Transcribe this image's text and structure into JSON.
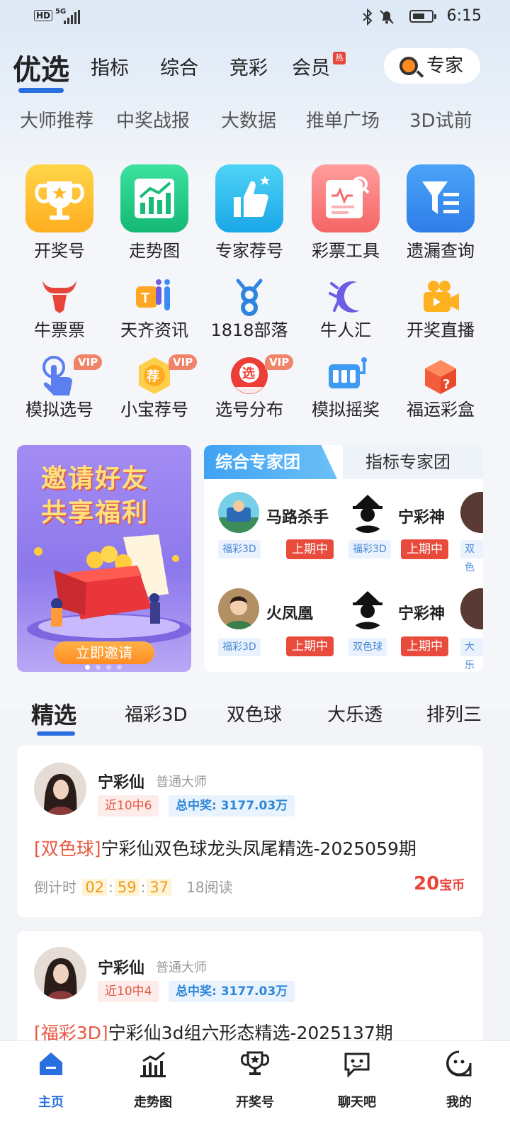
{
  "status_bar": {
    "hd": "HD",
    "network": "5G",
    "time": "6:15"
  },
  "top_nav": {
    "main": "优选",
    "tabs": [
      "指标",
      "综合",
      "竞彩",
      "会员"
    ],
    "hot_badge": "热",
    "expert_button": "专家"
  },
  "sub_nav": [
    "大师推荐",
    "中奖战报",
    "大数据",
    "推单广场",
    "3D试前"
  ],
  "main_tools": [
    {
      "label": "开奖号",
      "icon": "trophy-icon"
    },
    {
      "label": "走势图",
      "icon": "trend-chart-icon"
    },
    {
      "label": "专家荐号",
      "icon": "thumbs-up-icon"
    },
    {
      "label": "彩票工具",
      "icon": "lottery-tool-icon"
    },
    {
      "label": "遗漏查询",
      "icon": "filter-icon"
    }
  ],
  "row2_tools": [
    {
      "label": "牛票票",
      "icon": "bull-icon"
    },
    {
      "label": "天齐资讯",
      "icon": "tianqi-icon"
    },
    {
      "label": "1818部落",
      "icon": "tribe-icon"
    },
    {
      "label": "牛人汇",
      "icon": "niurenhui-icon"
    },
    {
      "label": "开奖直播",
      "icon": "video-camera-icon"
    }
  ],
  "row3_tools": [
    {
      "label": "模拟选号",
      "icon": "tap-hand-icon",
      "badge": "VIP"
    },
    {
      "label": "小宝荐号",
      "icon": "recommend-badge-icon",
      "badge": "VIP"
    },
    {
      "label": "选号分布",
      "icon": "select-ball-icon",
      "badge": "VIP"
    },
    {
      "label": "模拟摇奖",
      "icon": "draw-machine-icon",
      "badge": ""
    },
    {
      "label": "福运彩盒",
      "icon": "mystery-box-icon",
      "badge": ""
    }
  ],
  "invite": {
    "line1": "邀请好友",
    "line2": "共享福利",
    "button": "立即邀请"
  },
  "expert_team": {
    "tabs": [
      "综合专家团",
      "指标专家团"
    ],
    "experts": [
      {
        "name": "马路杀手",
        "lottery": "福彩3D",
        "status": "上期中"
      },
      {
        "name": "宁彩神",
        "lottery": "福彩3D",
        "status": "上期中"
      },
      {
        "name": "",
        "lottery": "双色",
        "status": ""
      },
      {
        "name": "火凤凰",
        "lottery": "福彩3D",
        "status": "上期中"
      },
      {
        "name": "宁彩神",
        "lottery": "双色球",
        "status": "上期中"
      },
      {
        "name": "",
        "lottery": "大乐",
        "status": ""
      }
    ]
  },
  "lottery_tabs": [
    "精选",
    "福彩3D",
    "双色球",
    "大乐透",
    "排列三"
  ],
  "posts": [
    {
      "author": "宁彩仙",
      "level": "普通大师",
      "recent": "近10中6",
      "total_label": "总中奖:",
      "total": "3177.03万",
      "tag": "[双色球]",
      "title": "宁彩仙双色球龙头凤尾精选-2025059期",
      "countdown_label": "倒计时",
      "h": "02",
      "m": "59",
      "s": "37",
      "reads": "18阅读",
      "price": "20",
      "price_unit": "宝币"
    },
    {
      "author": "宁彩仙",
      "level": "普通大师",
      "recent": "近10中4",
      "total_label": "总中奖:",
      "total": "3177.03万",
      "tag": "[福彩3D]",
      "title": "宁彩仙3d组六形态精选-2025137期"
    }
  ],
  "bottom_nav": [
    {
      "label": "主页",
      "icon": "home-icon",
      "active": true
    },
    {
      "label": "走势图",
      "icon": "trend-icon",
      "active": false
    },
    {
      "label": "开奖号",
      "icon": "trophy-icon",
      "active": false
    },
    {
      "label": "聊天吧",
      "icon": "chat-icon",
      "active": false
    },
    {
      "label": "我的",
      "icon": "profile-icon",
      "active": false
    }
  ],
  "colors": {
    "accent": "#2a6fe0",
    "red": "#e84b3c"
  }
}
